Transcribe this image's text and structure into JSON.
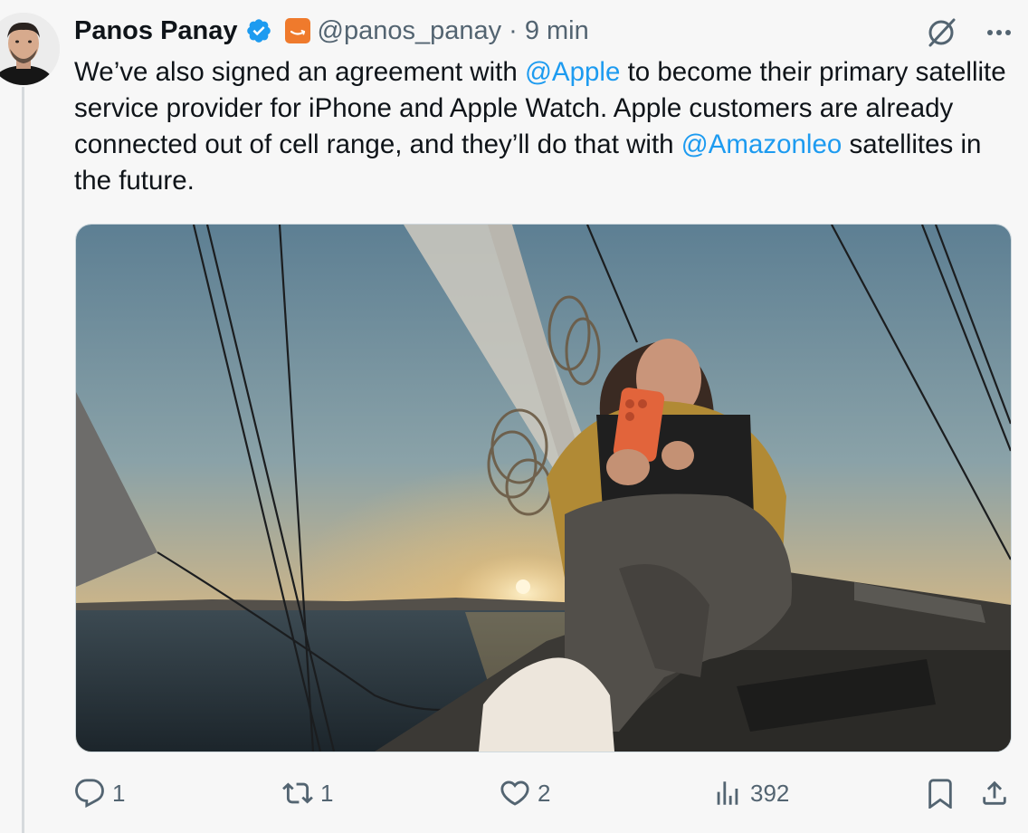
{
  "tweet": {
    "author": {
      "name": "Panos Panay",
      "handle": "@panos_panay",
      "verified_color": "#1d9bf0",
      "affiliation_icon": "amazon-smile-icon",
      "affiliation_color": "#ef7a2c"
    },
    "separator": "·",
    "time": "9 min",
    "text_parts": {
      "p1": "We’ve also signed an agreement with ",
      "mention1": "@Apple",
      "p2": " to become their primary satellite service provider for iPhone and Apple Watch. Apple customers are already connected out of cell range, and they’ll do that with ",
      "mention2": "@Amazonleo",
      "p3": " satellites in the future."
    },
    "media": {
      "kind": "photo",
      "subject": "sailboat-at-sunset-woman-holding-orange-phone"
    },
    "actions": {
      "replies": "1",
      "reposts": "1",
      "likes": "2",
      "views": "392"
    },
    "icons": {
      "top": [
        "grok-icon",
        "more-icon"
      ],
      "bar": [
        "reply-icon",
        "repost-icon",
        "like-icon",
        "views-icon",
        "bookmark-icon",
        "share-icon"
      ]
    }
  },
  "colors": {
    "background": "#f7f7f7",
    "text": "#0f1419",
    "muted": "#536471",
    "link": "#1d9bf0"
  }
}
